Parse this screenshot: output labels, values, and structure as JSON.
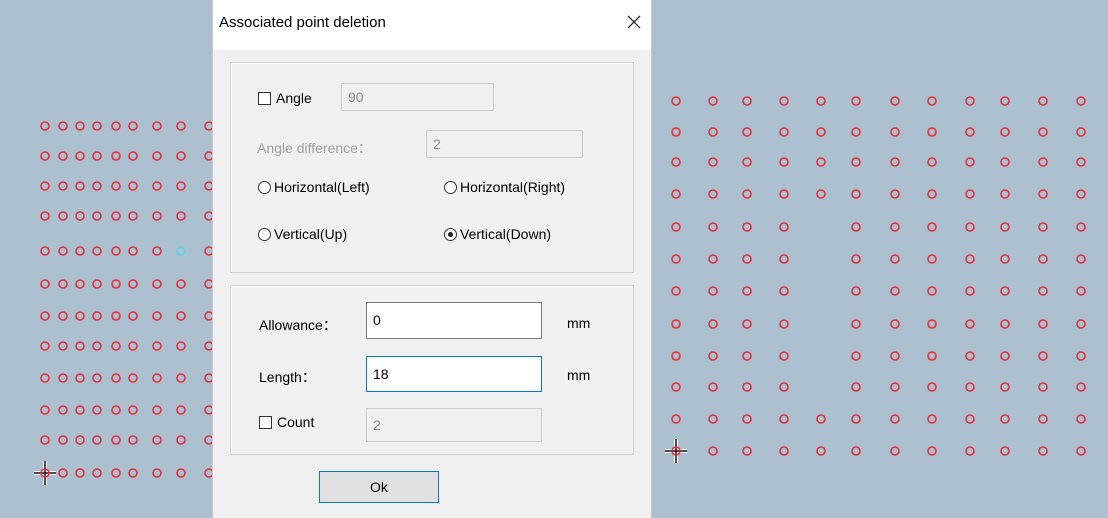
{
  "dialog": {
    "title": "Associated point deletion",
    "close_glyph": "×",
    "angle": {
      "label": "Angle",
      "checked": false,
      "value": "90"
    },
    "angle_difference": {
      "label": "Angle difference：",
      "value": "2"
    },
    "direction": {
      "options": [
        "Horizontal(Left)",
        "Horizontal(Right)",
        "Vertical(Up)",
        "Vertical(Down)"
      ],
      "selected": "Vertical(Down)"
    },
    "allowance": {
      "label": "Allowance：",
      "value": "0",
      "unit": "mm"
    },
    "length": {
      "label": "Length：",
      "value": "18",
      "unit": "mm"
    },
    "count": {
      "label": "Count",
      "checked": false,
      "value": "2"
    },
    "ok_label": "Ok"
  },
  "colors": {
    "canvas_background": "#adc0cf",
    "point": "#e0303c",
    "selected_point": "#5ed6f0",
    "dialog_background": "#f0f0f0",
    "accent": "#0078d7"
  },
  "icons": {
    "cursor": "crosshair-cursor-icon",
    "point": "circle-point-icon"
  }
}
